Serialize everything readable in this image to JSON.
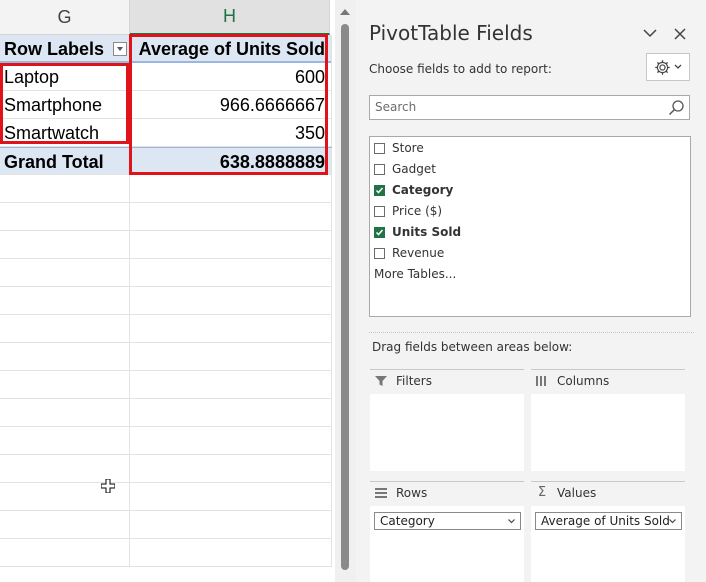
{
  "sheet": {
    "columns": {
      "g": "G",
      "h": "H"
    },
    "pivot": {
      "row_labels_header": "Row Labels",
      "value_header": "Average of Units Sold",
      "rows": [
        {
          "label": "Laptop",
          "value": "600"
        },
        {
          "label": "Smartphone",
          "value": "966.6666667"
        },
        {
          "label": "Smartwatch",
          "value": "350"
        }
      ],
      "grand_total_label": "Grand Total",
      "grand_total_value": "638.8888889"
    }
  },
  "pane": {
    "title": "PivotTable Fields",
    "choose_label": "Choose fields to add to report:",
    "search_placeholder": "Search",
    "fields": [
      {
        "label": "Store",
        "checked": false
      },
      {
        "label": "Gadget",
        "checked": false
      },
      {
        "label": "Category",
        "checked": true
      },
      {
        "label": "Price ($)",
        "checked": false
      },
      {
        "label": "Units Sold",
        "checked": true
      },
      {
        "label": "Revenue",
        "checked": false
      }
    ],
    "more_tables": "More Tables...",
    "drag_label": "Drag fields between areas below:",
    "areas": {
      "filters": "Filters",
      "columns": "Columns",
      "rows": "Rows",
      "values": "Values"
    },
    "rows_item": "Category",
    "values_item": "Average of Units Sold"
  },
  "colors": {
    "accent": "#217346",
    "highlight": "#e0131b",
    "pivot_band": "#dde7f4"
  }
}
